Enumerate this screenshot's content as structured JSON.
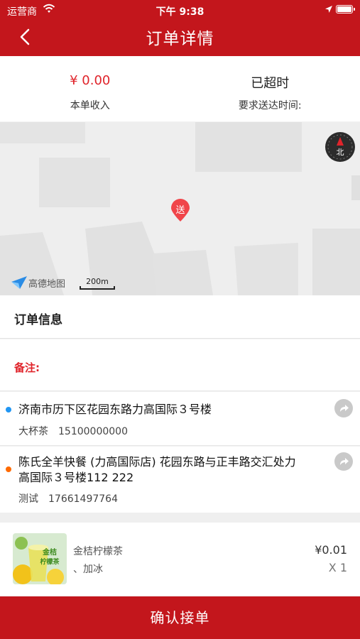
{
  "status_bar": {
    "carrier": "运营商",
    "time": "下午 9:38"
  },
  "nav": {
    "title": "订单详情"
  },
  "summary": {
    "income_value": "¥ 0.00",
    "income_label": "本单收入",
    "deadline_value": "已超时",
    "deadline_label": "要求送达时间:"
  },
  "map": {
    "marker_label": "送",
    "compass_label": "北",
    "provider": "高德地图",
    "scale_label": "200m"
  },
  "order_info": {
    "title": "订单信息",
    "remark_label": "备注:"
  },
  "delivery": {
    "address": "济南市历下区花园东路力高国际３号楼",
    "contact_name": "大杯茶",
    "contact_phone": "15100000000",
    "dot_color": "#2196f3"
  },
  "pickup": {
    "address_line1": "陈氏全羊快餐 (力高国际店) 花园东路与正丰路交汇处力",
    "address_line2": "高国际３号楼112 222",
    "contact_name": "测试",
    "contact_phone": "17661497764",
    "dot_color": "#ff6a00"
  },
  "product": {
    "name": "金桔柠檬茶",
    "spec": "、加冰",
    "price": "¥0.01",
    "quantity": "X 1",
    "image_text_line1": "金桔",
    "image_text_line2": "柠檬茶"
  },
  "actions": {
    "confirm_label": "确认接单"
  },
  "colors": {
    "brand_red": "#c3161c",
    "accent_red": "#e0242b"
  }
}
